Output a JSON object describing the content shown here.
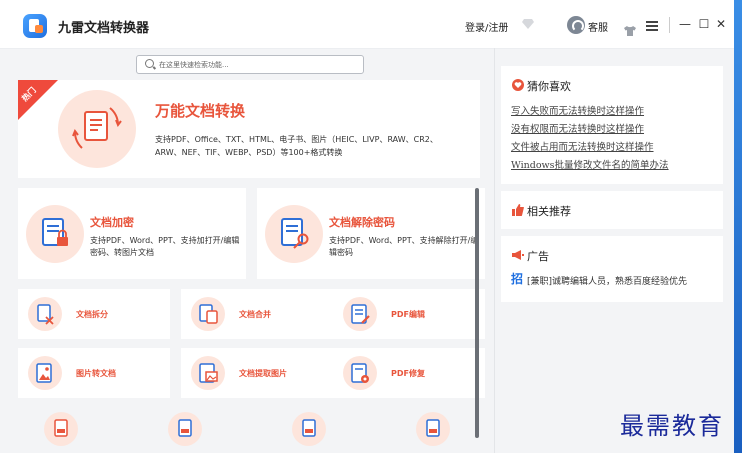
{
  "app": {
    "title": "九雷文档转换器",
    "login_label": "登录/注册",
    "service_label": "客服"
  },
  "window_controls": {
    "minimize": "—",
    "maximize": "☐",
    "close": "✕"
  },
  "search": {
    "placeholder": "在这里快速检索功能..."
  },
  "hero": {
    "badge": "热门",
    "title": "万能文档转换",
    "description": "支持PDF、Office、TXT、HTML、电子书、图片（HEIC、LIVP、RAW、CR2、ARW、NEF、TIF、WEBP、PSD）等100+格式转换"
  },
  "big_cards": [
    {
      "title": "文档加密",
      "description": "支持PDF、Word、PPT、支持加打开/编辑密码、转图片文档"
    },
    {
      "title": "文档解除密码",
      "description": "支持PDF、Word、PPT、支持解除打开/编辑密码"
    }
  ],
  "small_cards": [
    {
      "title": "文档拆分"
    },
    {
      "title": "文档合并"
    },
    {
      "title": "PDF编辑"
    },
    {
      "title": "图片转文档"
    },
    {
      "title": "文档提取图片"
    },
    {
      "title": "PDF修复"
    }
  ],
  "guess": {
    "title": "猜你喜欢",
    "links": [
      "写入失败而无法转换时这样操作",
      "没有权限而无法转换时这样操作",
      "文件被占用而无法转换时这样操作",
      "Windows批量修改文件名的简单办法"
    ]
  },
  "recommend": {
    "title": "相关推荐"
  },
  "ad": {
    "title": "广告",
    "badge": "招",
    "text": "[兼职]诚聘编辑人员，熟悉百度经验优先"
  },
  "watermark": "最需教育",
  "colors": {
    "accent": "#e8553c",
    "ribbon": "#ef4a3c",
    "icon_bg": "#fde5dc",
    "link_blue": "#1f6fe0"
  }
}
